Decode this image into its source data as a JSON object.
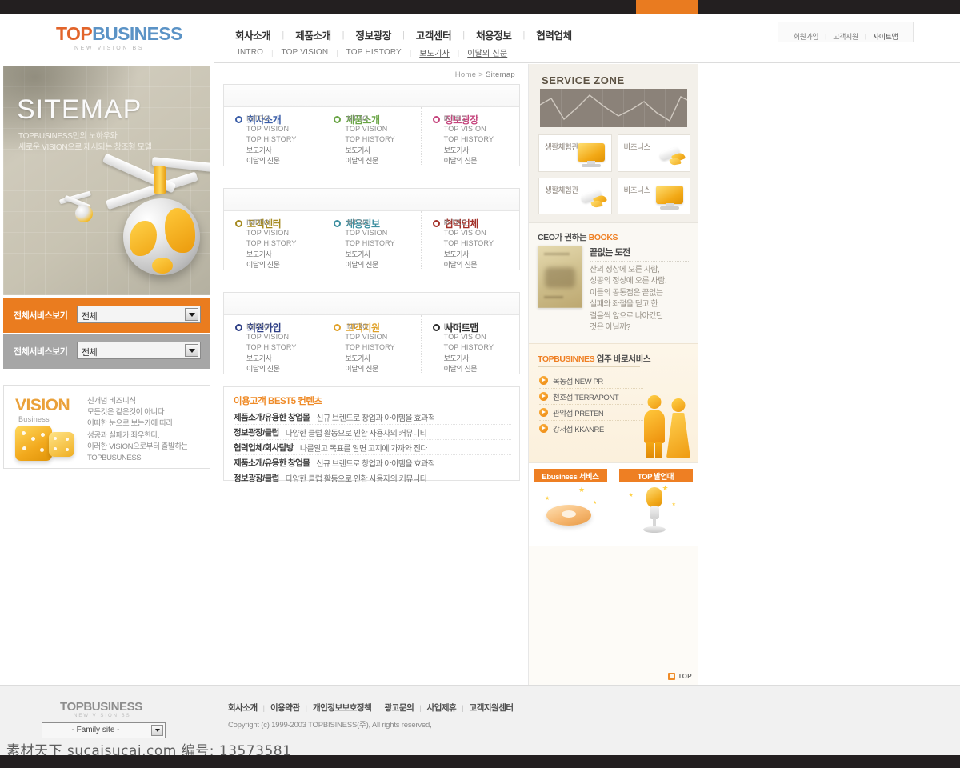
{
  "brand": {
    "logo_top": "TOP",
    "logo_rest": "BUSINESS",
    "logo_tagline": "NEW VISION BS",
    "footer_logo": "TOPBUSINESS",
    "footer_logo_tagline": "NEW VISION BS",
    "accent_orange": "#ea7c1f",
    "accent_blue": "#5b93c6",
    "accent_red": "#e2642a"
  },
  "nav": {
    "main": [
      {
        "label": "회사소개"
      },
      {
        "label": "제품소개"
      },
      {
        "label": "정보광장"
      },
      {
        "label": "고객센터"
      },
      {
        "label": "채용정보"
      },
      {
        "label": "협력업체"
      }
    ],
    "separator": "|",
    "util": [
      {
        "label": "회원가입"
      },
      {
        "label": "고객지원"
      },
      {
        "label": "사이트맵"
      }
    ],
    "sub": [
      {
        "label": "INTRO",
        "ko": false
      },
      {
        "label": "TOP VISION",
        "ko": false
      },
      {
        "label": "TOP HISTORY",
        "ko": false
      },
      {
        "label": "보도기사",
        "ko": true
      },
      {
        "label": "이달의 신문",
        "ko": true
      }
    ]
  },
  "hero": {
    "title": "SITEMAP",
    "line1": "TOPBUSINESS만의 노하우와",
    "line2": "새로운 VISION으로 제시되는 창조형 모델"
  },
  "service_selects": [
    {
      "label": "전체서비스보기",
      "value": "전체",
      "style": "orange"
    },
    {
      "label": "전체서비스보기",
      "value": "전체",
      "style": "gray"
    }
  ],
  "vision": {
    "title": "VISION",
    "subtitle": "Business",
    "text": "신개념 비즈니식\n모든것은 같은것이 아니다\n어떠한 눈으로 보는가에 따라\n성공과 실패가 좌우한다.\n이러한 VISION으로부터 출발하는\nTOPBUSUNESS"
  },
  "breadcrumb": {
    "home": "Home",
    "sep": ">",
    "current": "Sitemap"
  },
  "sitemap": {
    "link_labels": [
      "INTRO",
      "TOP VISION",
      "TOP HISTORY",
      "보도기사",
      "이달의 신문"
    ],
    "rows": [
      {
        "cols": [
          {
            "title": "회사소개",
            "color": "#3b5ea8"
          },
          {
            "title": "제품소개",
            "color": "#6aa546"
          },
          {
            "title": "정보광장",
            "color": "#c5447c"
          }
        ]
      },
      {
        "cols": [
          {
            "title": "고객센터",
            "color": "#a58a20"
          },
          {
            "title": "채용정보",
            "color": "#3d8fa0"
          },
          {
            "title": "협력업체",
            "color": "#a33028"
          }
        ]
      },
      {
        "cols": [
          {
            "title": "회원가입",
            "color": "#2e3f86"
          },
          {
            "title": "고객지원",
            "color": "#e0a128"
          },
          {
            "title": "사이트맵",
            "color": "#2b2b2b"
          }
        ]
      }
    ]
  },
  "best5": {
    "title": "이용고객 BEST5 컨텐츠",
    "rows": [
      {
        "cat": "제품소개/유용한 창업몰",
        "desc": "신규 브렌드로 창업과 아이템을 효과적"
      },
      {
        "cat": "정보광장/클럽",
        "desc": "다양한 클럽 활동으로 인환 사용자의 커뮤니티"
      },
      {
        "cat": "협력업체/회사탐방",
        "desc": "나를알고 목표를 알면 고지에 가까와 진다"
      },
      {
        "cat": "제품소개/유용한 창업몰",
        "desc": "신규 브렌드로 창업과 아이템을 효과적"
      },
      {
        "cat": "정보광장/클럽",
        "desc": "다양한 클럽 활동으로 인환 사용자의 커뮤니티"
      }
    ]
  },
  "service_zone": {
    "title": "SERVICE ZONE",
    "tiles": [
      {
        "label": "생활체험관",
        "icon": "monitor-icon"
      },
      {
        "label": "비즈니스",
        "icon": "rocket-icon"
      },
      {
        "label": "생활체험관",
        "icon": "rocket-icon"
      },
      {
        "label": "비즈니스",
        "icon": "monitor-icon"
      }
    ]
  },
  "ceo_books": {
    "title_prefix": "CEO가 권하는 ",
    "title_accent": "BOOKS",
    "book_title": "끝없는 도전",
    "book_desc": "산의 정상에 오른 사람,\n성공의 정상에 오른 사람.\n이들의 공통점은 끝없는\n실패와 좌절을 딛고 한\n걸음씩 앞으로 나아갔던\n것은 아닐까?"
  },
  "entry_service": {
    "title_accent": "TOPBUSINNES",
    "title_rest": " 입주 바로서비스",
    "items": [
      {
        "label": "목동점 NEW PR"
      },
      {
        "label": "천호점 TERRAPONT"
      },
      {
        "label": "관악점 PRETEN"
      },
      {
        "label": "강서점 KKANRE"
      }
    ]
  },
  "banners": [
    {
      "caption": "Ebusiness 서비스",
      "icon": "donut-icon"
    },
    {
      "caption": "TOP 발언대",
      "icon": "microphone-icon"
    }
  ],
  "top_button": {
    "label": "TOP"
  },
  "footer": {
    "family_site": "- Family site -",
    "links": [
      {
        "label": "회사소개"
      },
      {
        "label": "이용약관"
      },
      {
        "label": "개인정보보호정책"
      },
      {
        "label": "광고문의"
      },
      {
        "label": "사업제휴"
      },
      {
        "label": "고객지원센터"
      }
    ],
    "separator": "|",
    "copyright": "Copyright (c) 1999-2003 TOPBISINESS(주), All rights reserved,"
  },
  "watermark": {
    "text": "素材天下 sucaisucai.com  编号: 13573581"
  }
}
